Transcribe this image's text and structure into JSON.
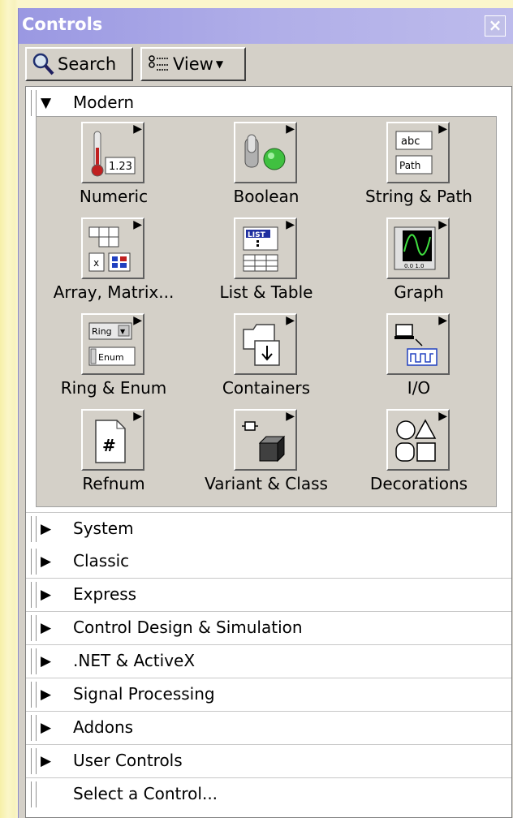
{
  "window": {
    "title": "Controls"
  },
  "toolbar": {
    "search_label": "Search",
    "view_label": "View"
  },
  "modern": {
    "label": "Modern",
    "items": [
      {
        "label": "Numeric"
      },
      {
        "label": "Boolean"
      },
      {
        "label": "String & Path"
      },
      {
        "label": "Array, Matrix..."
      },
      {
        "label": "List & Table"
      },
      {
        "label": "Graph"
      },
      {
        "label": "Ring & Enum"
      },
      {
        "label": "Containers"
      },
      {
        "label": "I/O"
      },
      {
        "label": "Refnum"
      },
      {
        "label": "Variant & Class"
      },
      {
        "label": "Decorations"
      }
    ]
  },
  "tile_text": {
    "numeric_value": "1.23",
    "string_abc": "abc",
    "string_path": "Path",
    "list": "LIST",
    "ring": "Ring",
    "enum": "Enum",
    "graph_ticks": "0.0 1.0"
  },
  "categories": [
    {
      "label": "System"
    },
    {
      "label": "Classic"
    },
    {
      "label": "Express"
    },
    {
      "label": "Control Design & Simulation"
    },
    {
      "label": ".NET & ActiveX"
    },
    {
      "label": "Signal Processing"
    },
    {
      "label": "Addons"
    },
    {
      "label": "User Controls"
    },
    {
      "label": "Select a Control..."
    }
  ],
  "icons": {
    "expanded": "triangle-down-icon",
    "collapsed": "triangle-right-icon",
    "search": "magnifier-icon",
    "view": "view-list-icon"
  }
}
